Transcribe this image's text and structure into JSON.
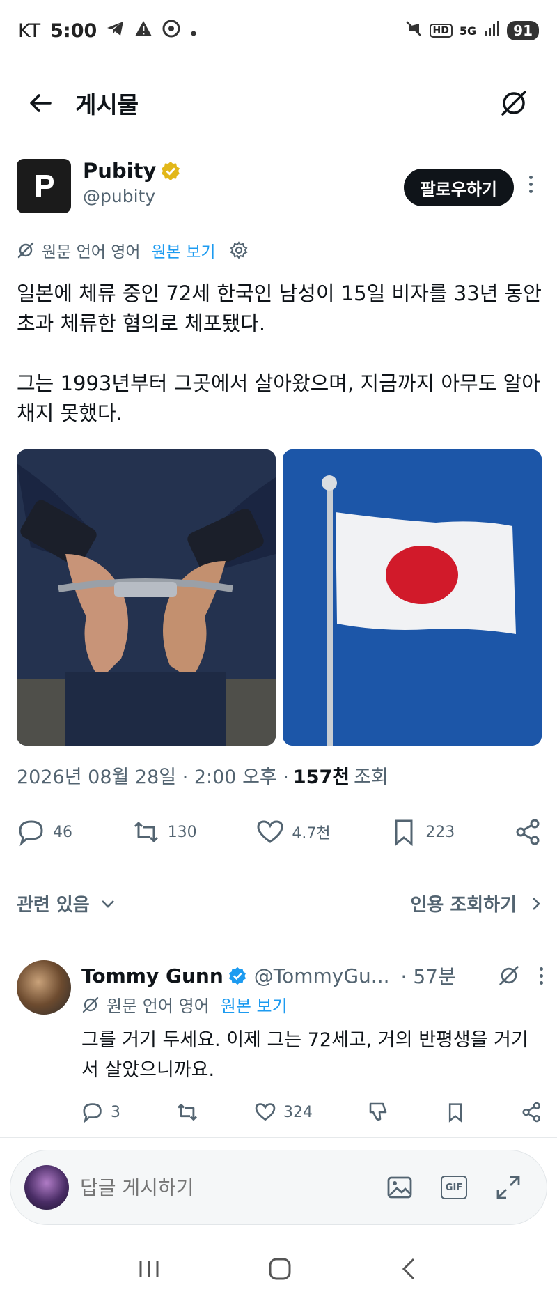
{
  "status_bar": {
    "carrier": "KT",
    "time": "5:00",
    "hd": "HD",
    "network": "5G",
    "battery": "91"
  },
  "header": {
    "title": "게시물"
  },
  "post": {
    "author_name": "Pubity",
    "author_handle": "@pubity",
    "follow_label": "팔로우하기",
    "translate_label": "원문 언어 영어",
    "original_link": "원본 보기",
    "text": "일본에 체류 중인 72세 한국인 남성이 15일 비자를 33년 동안 초과 체류한 혐의로 체포됐다.\n\n그는 1993년부터 그곳에서 살아왔으며, 지금까지 아무도 알아채지 못했다.",
    "timestamp": "2026년 08월 28일 · 2:00 오후 ·",
    "views_count": "157천",
    "views_label": "조회",
    "stats": {
      "replies": "46",
      "reposts": "130",
      "likes": "4.7천",
      "bookmarks": "223"
    }
  },
  "related": {
    "label": "관련 있음",
    "quotes_label": "인용 조회하기"
  },
  "reply": {
    "name": "Tommy Gunn",
    "handle": "@TommyGu...",
    "time": "· 57분",
    "translate_label": "원문 언어 영어",
    "original_link": "원본 보기",
    "text": "그를 거기 두세요. 이제 그는 72세고, 거의 반평생을 거기서 살았으니까요.",
    "stats": {
      "replies": "3",
      "likes": "324"
    }
  },
  "compose": {
    "placeholder": "답글 게시하기",
    "gif_label": "GIF"
  },
  "colors": {
    "accent": "#1d9bf0",
    "verified_gold": "#e2b719",
    "verified_blue": "#1d9bf0",
    "text_primary": "#0f1419",
    "text_secondary": "#536471"
  }
}
